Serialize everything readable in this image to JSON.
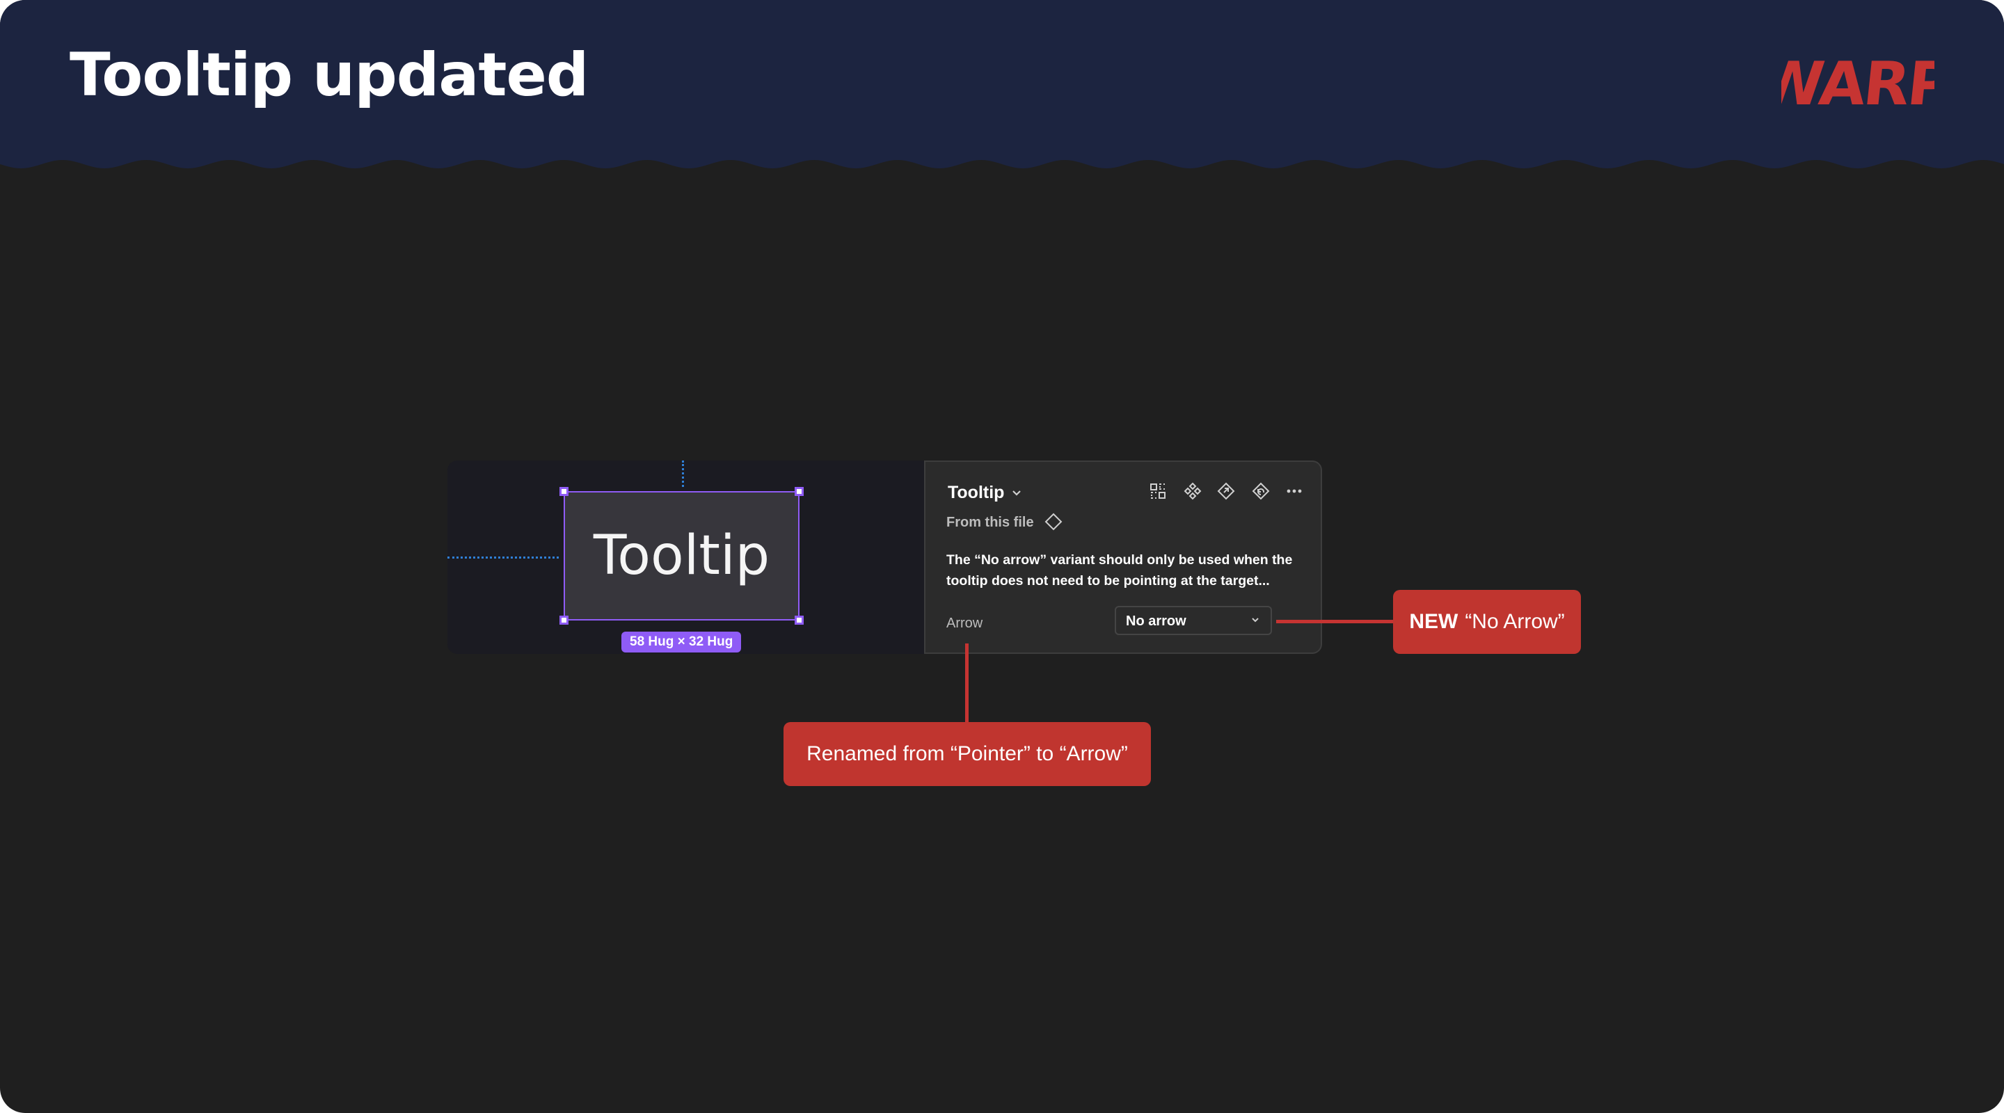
{
  "header": {
    "title": "Tooltip updated",
    "logo_text": "WARP",
    "background_color": "#1c2440",
    "logo_color": "#c63432"
  },
  "canvas": {
    "tooltip_text": "Tooltip",
    "size_badge": "58 Hug × 32 Hug",
    "selection_color": "#8f5cf6"
  },
  "panel": {
    "component_name": "Tooltip",
    "source_label": "From this file",
    "description": "The “No arrow” variant should only be used when the tooltip does not need to be pointing at the target...",
    "property_label": "Arrow",
    "property_value": "No arrow",
    "icons": [
      "select-matching-layers-icon",
      "component-icon",
      "go-to-main-component-icon",
      "reset-icon",
      "more-icon"
    ]
  },
  "callouts": {
    "new_strong": "NEW",
    "new_text": "“No Arrow”",
    "renamed_text": "Renamed from “Pointer” to “Arrow”",
    "color": "#c0352f"
  }
}
